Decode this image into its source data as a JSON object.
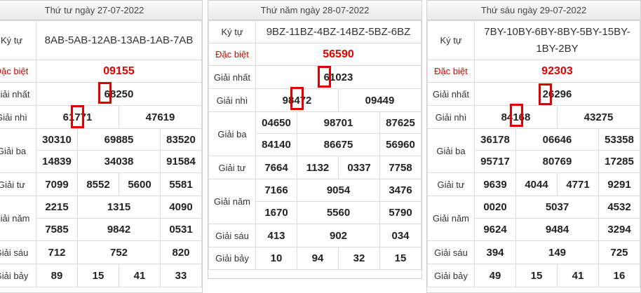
{
  "panels": [
    {
      "date": "Thứ tư ngày 27-07-2022",
      "ky_tu_label": "Ký tự",
      "ky_tu": "8AB-5AB-12AB-13AB-1AB-7AB",
      "dac_biet_label": "Đặc biệt",
      "dac_biet": "09155",
      "g1_label": "Giải nhất",
      "g1": "68250",
      "g2_label": "Giải nhì",
      "g2": [
        "61771",
        "47619"
      ],
      "g3_label": "Giải ba",
      "g3": [
        "30310",
        "69885",
        "83520",
        "14839",
        "34038",
        "91584"
      ],
      "g4_label": "Giải tư",
      "g4": [
        "7099",
        "8552",
        "5600",
        "5581"
      ],
      "g5_label": "Giải năm",
      "g5": [
        "2215",
        "1315",
        "4090",
        "7585",
        "9842",
        "0531"
      ],
      "g6_label": "Giải sáu",
      "g6": [
        "712",
        "752",
        "820"
      ],
      "g7_label": "Giải bảy",
      "g7": [
        "89",
        "15",
        "41",
        "33"
      ]
    },
    {
      "date": "Thứ năm ngày 28-07-2022",
      "ky_tu_label": "Ký tự",
      "ky_tu": "9BZ-11BZ-4BZ-14BZ-5BZ-6BZ",
      "dac_biet_label": "Đặc biệt",
      "dac_biet": "56590",
      "g1_label": "Giải nhất",
      "g1": "61023",
      "g2_label": "Giải nhì",
      "g2": [
        "98472",
        "09449"
      ],
      "g3_label": "Giải ba",
      "g3": [
        "04650",
        "98701",
        "87625",
        "84140",
        "86675",
        "56960"
      ],
      "g4_label": "Giải tư",
      "g4": [
        "7664",
        "1132",
        "0337",
        "7758"
      ],
      "g5_label": "Giải năm",
      "g5": [
        "7166",
        "9054",
        "3476",
        "1670",
        "5560",
        "5790"
      ],
      "g6_label": "Giải sáu",
      "g6": [
        "413",
        "902",
        "034"
      ],
      "g7_label": "Giải bảy",
      "g7": [
        "10",
        "94",
        "32",
        "15"
      ]
    },
    {
      "date": "Thứ sáu ngày 29-07-2022",
      "ky_tu_label": "Ký tự",
      "ky_tu": "7BY-10BY-6BY-8BY-5BY-15BY-1BY-2BY",
      "dac_biet_label": "Đặc biệt",
      "dac_biet": "92303",
      "g1_label": "Giải nhất",
      "g1": "26296",
      "g2_label": "Giải nhì",
      "g2": [
        "84168",
        "43275"
      ],
      "g3_label": "Giải ba",
      "g3": [
        "36178",
        "06646",
        "53358",
        "95717",
        "80769",
        "17285"
      ],
      "g4_label": "Giải tư",
      "g4": [
        "9639",
        "4044",
        "4771",
        "9291"
      ],
      "g5_label": "Giải năm",
      "g5": [
        "0020",
        "5037",
        "4532",
        "9624",
        "9484",
        "3294"
      ],
      "g6_label": "Giải sáu",
      "g6": [
        "394",
        "149",
        "725"
      ],
      "g7_label": "Giải bảy",
      "g7": [
        "49",
        "15",
        "41",
        "16"
      ]
    }
  ],
  "highlight_color": "#e00000",
  "dac_biet_color": "#e00000"
}
